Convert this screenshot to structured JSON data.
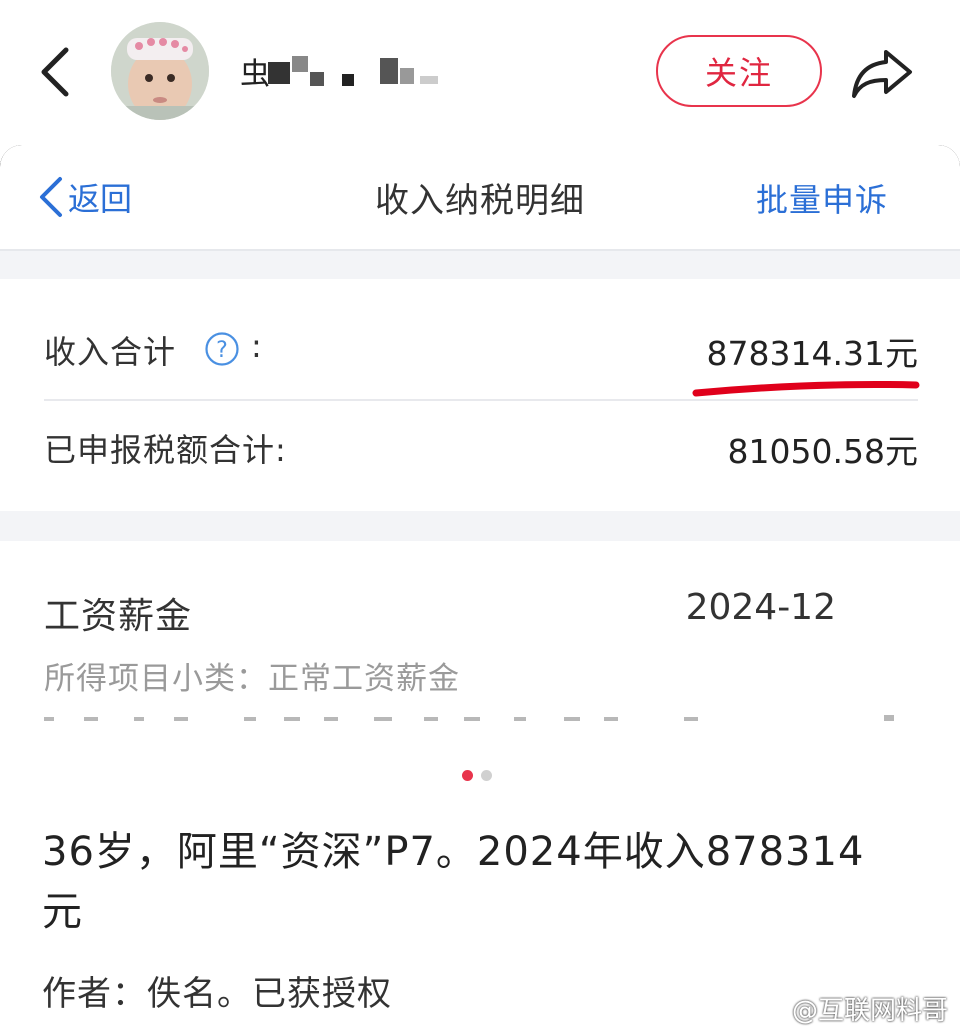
{
  "header": {
    "follow_label": "关注"
  },
  "card": {
    "nav": {
      "back_label": "返回",
      "title": "收入纳税明细",
      "action_label": "批量申诉"
    },
    "summary": {
      "income_label": "收入合计",
      "colon": ":",
      "income_value": "878314.31元",
      "tax_label": "已申报税额合计:",
      "tax_value": "81050.58元"
    },
    "item": {
      "title": "工资薪金",
      "date": "2024-12",
      "subcategory": "所得项目小类：正常工资薪金"
    }
  },
  "pager": {
    "count": 2,
    "active_index": 0
  },
  "post": {
    "title": "36岁，阿里“资深”P7。2024年收入878314元",
    "author": "作者：佚名。已获授权",
    "watermark": "@互联网料哥"
  },
  "colors": {
    "accent_red": "#e8344c",
    "link_blue": "#2b6fd6",
    "highlight_underline": "#e0001b"
  }
}
